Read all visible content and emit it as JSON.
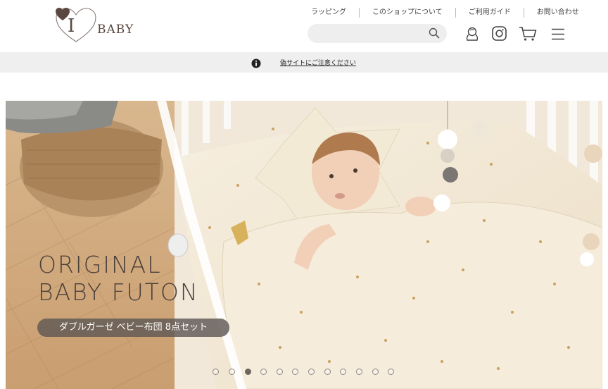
{
  "brand": {
    "logo_letter": "I",
    "logo_word": "BABY"
  },
  "top_nav": [
    {
      "label": "ラッピング"
    },
    {
      "label": "このショップについて"
    },
    {
      "label": "ご利用ガイド"
    },
    {
      "label": "お問い合わせ"
    }
  ],
  "search": {
    "placeholder": "",
    "icon": "search-icon"
  },
  "header_icons": [
    "account-icon",
    "instagram-icon",
    "cart-icon",
    "hamburger-menu-icon"
  ],
  "notice": {
    "icon": "info-icon",
    "text": "偽サイトにご注意ください"
  },
  "hero": {
    "title_line1": "ORIGINAL",
    "title_line2": "BABY FUTON",
    "subtitle": "ダブルガーゼ ベビー布団 8点セット",
    "slide_count": 12,
    "active_slide": 3
  },
  "colors": {
    "brand_brown": "#5a4740",
    "notice_bg": "#efefef",
    "search_bg": "#eeeeee",
    "pill_bg": "#5f5854"
  }
}
